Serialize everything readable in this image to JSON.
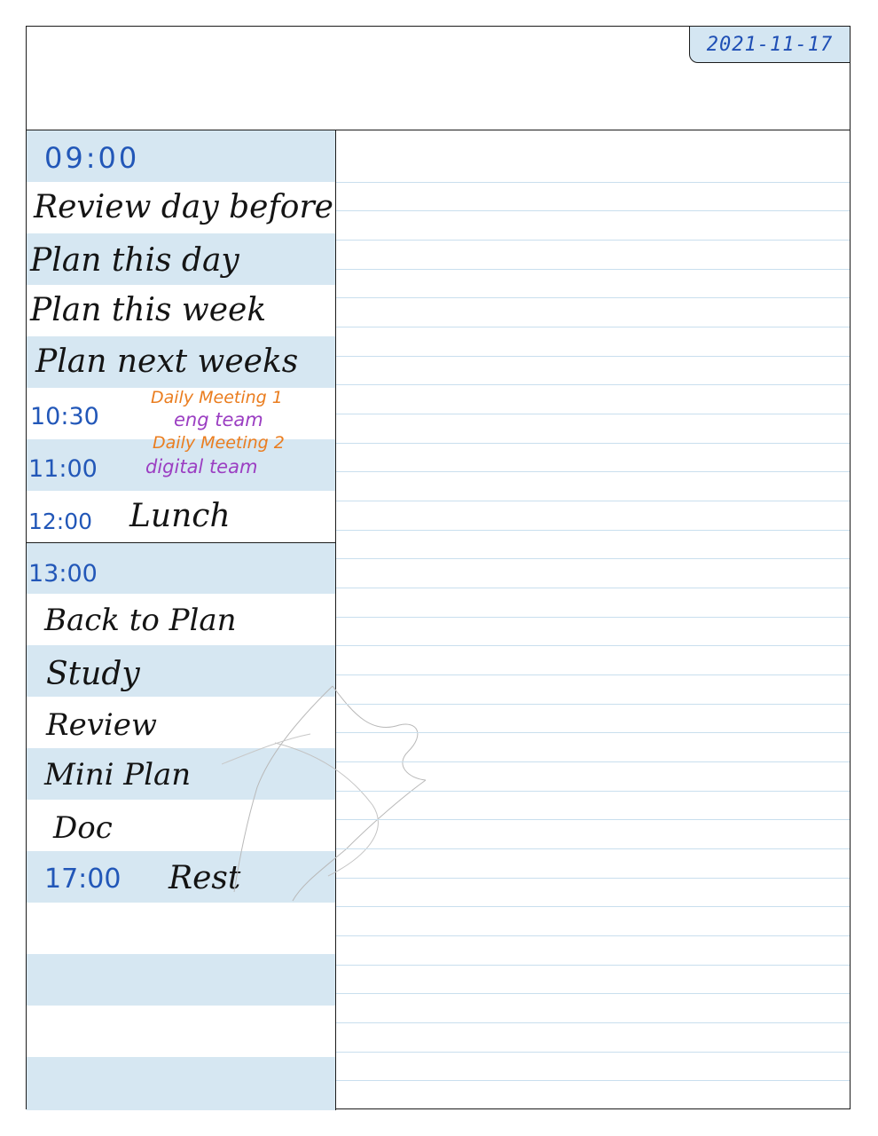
{
  "header": {
    "date": "2021-11-17"
  },
  "schedule": {
    "morning": {
      "time_0900": "09:00",
      "task_review_day_before": "Review day before",
      "task_plan_this_day": "Plan this day",
      "task_plan_this_week": "Plan this week",
      "task_plan_next_weeks": "Plan next weeks",
      "time_1030": "10:30",
      "meeting1_title": "Daily Meeting 1",
      "meeting1_team": "eng team",
      "time_1100": "11:00",
      "meeting2_title": "Daily Meeting 2",
      "meeting2_team": "digital team",
      "time_1200": "12:00",
      "lunch": "Lunch"
    },
    "afternoon": {
      "time_1300": "13:00",
      "task_back_to_plan": "Back to Plan",
      "task_study": "Study",
      "task_review": "Review",
      "task_mini_plan": "Mini Plan",
      "task_doc": "Doc",
      "time_1700": "17:00",
      "rest": "Rest"
    }
  },
  "colors": {
    "time_ink": "#2257b8",
    "meeting_title_ink": "#ea7d1f",
    "meeting_team_ink": "#9b3ec2",
    "row_shading": "#d6e7f2",
    "note_rule": "#c9dfee"
  }
}
